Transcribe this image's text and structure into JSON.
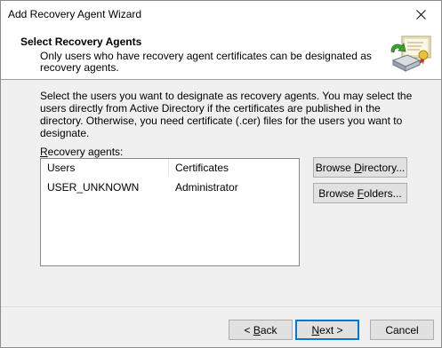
{
  "window": {
    "title": "Add Recovery Agent Wizard"
  },
  "header": {
    "title": "Select Recovery Agents",
    "description": "Only users who have recovery agent certificates can be designated as recovery agents.",
    "icon": "certificate-wizard-icon"
  },
  "main": {
    "instructions": "Select the users you want to designate as recovery agents. You may select the users directly from Active Directory if the certificates are published in the directory. Otherwise, you need certificate (.cer) files for the users you want to designate.",
    "list_label": "Recovery agents:",
    "columns": [
      "Users",
      "Certificates"
    ],
    "rows": [
      {
        "user": "USER_UNKNOWN",
        "certificate": "Administrator"
      }
    ],
    "buttons": {
      "browse_directory": "Browse Directory...",
      "browse_folders": "Browse Folders..."
    }
  },
  "footer": {
    "back": "< Back",
    "next": "Next >",
    "cancel": "Cancel"
  }
}
